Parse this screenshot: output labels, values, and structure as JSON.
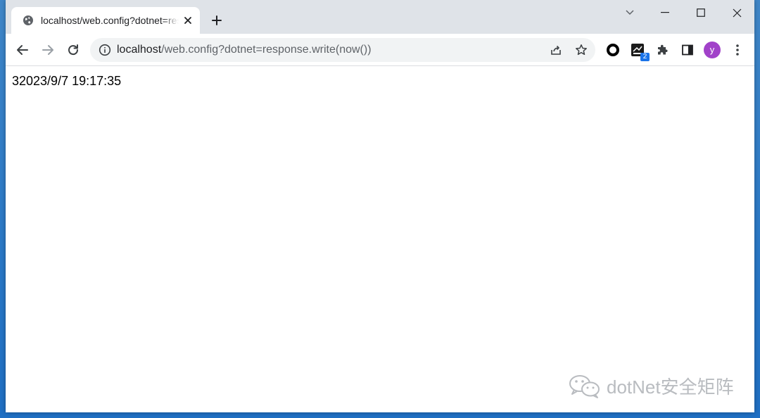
{
  "tab": {
    "title": "localhost/web.config?dotnet=response.write(now())",
    "favicon": "globe-icon"
  },
  "toolbar": {
    "url_host": "localhost",
    "url_path": "/web.config?dotnet=response.write(now())"
  },
  "extensions": {
    "badge_count": "2"
  },
  "profile": {
    "initial": "y",
    "color": "#a142c9"
  },
  "page": {
    "output": "32023/9/7 19:17:35"
  },
  "watermark": {
    "text": "dotNet安全矩阵"
  }
}
